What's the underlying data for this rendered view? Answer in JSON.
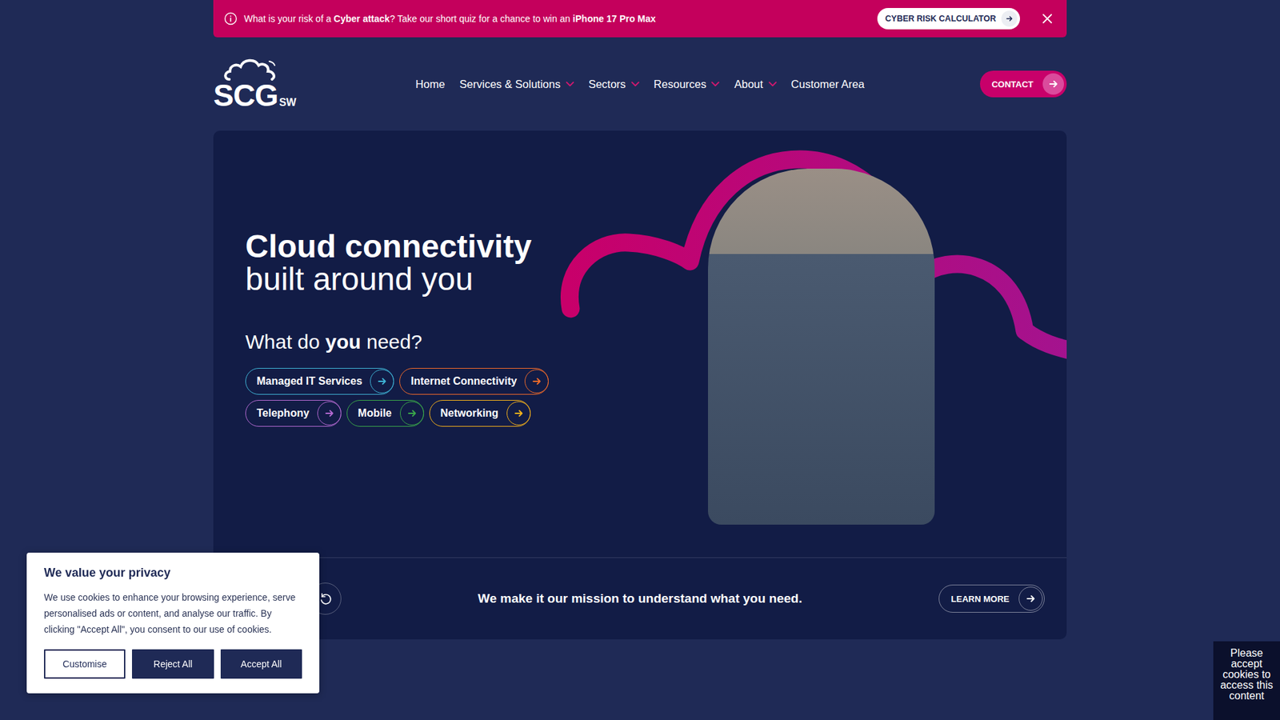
{
  "promo": {
    "parts": [
      {
        "text": "What is your risk of a ",
        "bold": false
      },
      {
        "text": "Cyber attack",
        "bold": true
      },
      {
        "text": "? Take our short quiz for a chance to win an ",
        "bold": false
      },
      {
        "text": "iPhone 17 Pro Max",
        "bold": true
      }
    ],
    "button": "CYBER RISK CALCULATOR"
  },
  "logo": {
    "main": "SCG",
    "sub": "SW"
  },
  "nav": [
    {
      "label": "Home",
      "dropdown": false
    },
    {
      "label": "Services & Solutions",
      "dropdown": true
    },
    {
      "label": "Sectors",
      "dropdown": true
    },
    {
      "label": "Resources",
      "dropdown": true
    },
    {
      "label": "About",
      "dropdown": true
    },
    {
      "label": "Customer Area",
      "dropdown": false
    }
  ],
  "contact_button": "CONTACT",
  "hero": {
    "title": "Cloud connectivity",
    "subtitle": "built around you",
    "question": [
      {
        "text": "What do ",
        "bold": false
      },
      {
        "text": "you",
        "bold": true
      },
      {
        "text": " need?",
        "bold": false
      }
    ],
    "services": [
      [
        {
          "label": "Managed IT Services",
          "color": "#3fb4d6"
        },
        {
          "label": "Internet Connectivity",
          "color": "#f26b2a"
        }
      ],
      [
        {
          "label": "Telephony",
          "color": "#b46ad2"
        },
        {
          "label": "Mobile",
          "color": "#3aa84a"
        },
        {
          "label": "Networking",
          "color": "#f5b21b"
        }
      ]
    ]
  },
  "mission": {
    "text": "We make it our mission to understand what you need.",
    "button": "LEARN MORE"
  },
  "cookie_banner": {
    "title": "We value your privacy",
    "body": "We use cookies to enhance your browsing experience, serve personalised ads or content, and analyse our traffic. By clicking \"Accept All\", you consent to our use of cookies.",
    "buttons": [
      {
        "label": "Customise",
        "kind": "outline"
      },
      {
        "label": "Reject All",
        "kind": "filled"
      },
      {
        "label": "Accept All",
        "kind": "filled"
      }
    ]
  },
  "cookie_notice": "Please accept cookies to access this content"
}
